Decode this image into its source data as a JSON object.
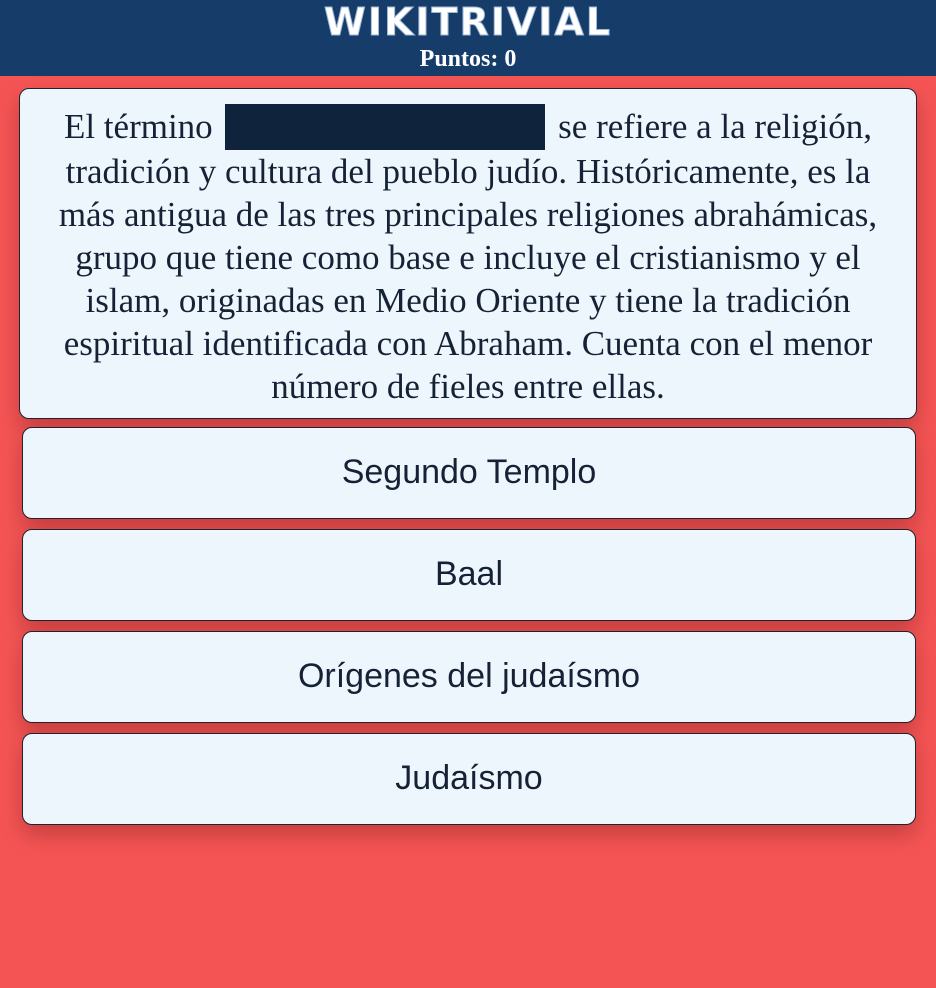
{
  "app": {
    "logo": "WIKITRIVIAL",
    "score_text": "Puntos: 0"
  },
  "colors": {
    "header_bg": "#163c6a",
    "page_bg": "#f55454",
    "card_bg": "#eef6fd",
    "redaction": "#0f233d",
    "text": "#152236"
  },
  "question": {
    "prefix": "El término",
    "suffix": "se refiere a la religión, tradición y cultura del pueblo judío. Históricamente, es la más antigua de las tres principales religiones abrahámicas, grupo que tiene como base e incluye el cristianismo y el islam, originadas en Medio Oriente y tiene la tradición espiritual identificada con Abraham. Cuenta con el menor número de fieles entre ellas."
  },
  "answers": [
    {
      "label": "Segundo Templo"
    },
    {
      "label": "Baal"
    },
    {
      "label": "Orígenes del judaísmo"
    },
    {
      "label": "Judaísmo"
    }
  ]
}
